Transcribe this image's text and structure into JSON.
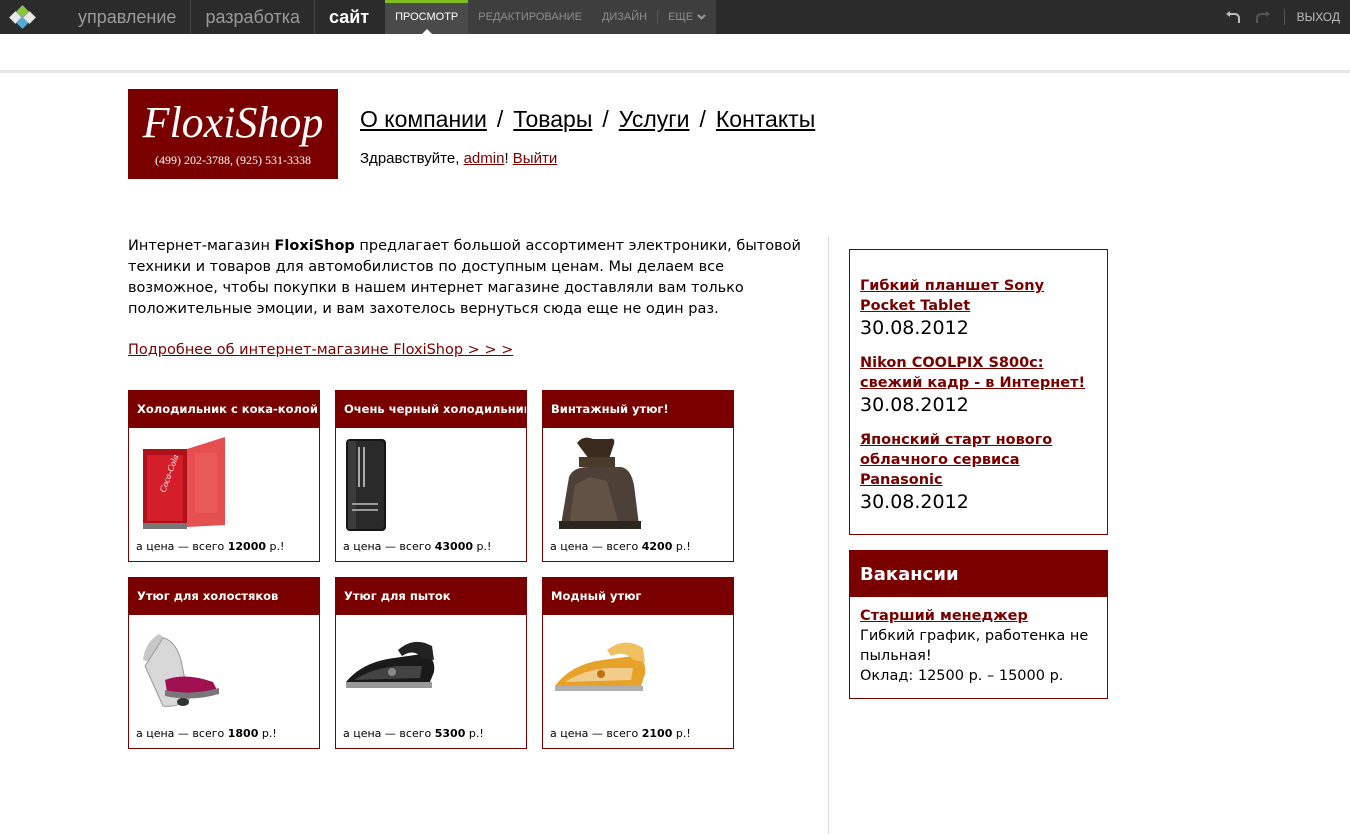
{
  "adminbar": {
    "main_nav": [
      "управление",
      "разработка",
      "сайт"
    ],
    "active_main": "сайт",
    "sub_nav": [
      "ПРОСМОТР",
      "РЕДАКТИРОВАНИЕ",
      "ДИЗАЙН"
    ],
    "more_label": "ЕЩЕ",
    "exit_label": "ВЫХОД",
    "accent": "#7fbf1f"
  },
  "brand": {
    "name": "FloxiShop",
    "phones": "(499) 202-3788, (925) 531-3338",
    "color": "#7a0000"
  },
  "menu": [
    "О компании",
    "Товары",
    "Услуги",
    "Контакты"
  ],
  "greeting": {
    "prefix": "Здравствуйте, ",
    "user": "admin",
    "suffix": "! ",
    "logout": "Выйти"
  },
  "intro": {
    "before": "Интернет-магазин ",
    "bold": "FloxiShop",
    "after": " предлагает большой ассортимент электроники, бытовой техники и товаров для автомобилистов по доступным ценам. Мы делаем все возможное, чтобы покупки в нашем интернет магазине доставляли вам только положительные эмоции, и вам захотелось вернуться сюда еще не один раз.",
    "more_link": "Подробнее об интернет-магазине FloxiShop > > >"
  },
  "products": [
    {
      "title": "Холодильник с кока-колой",
      "price_prefix": "а цена — всего ",
      "price": "12000",
      "currency": " р.!",
      "image": "red-mini-fridge"
    },
    {
      "title": "Очень черный холодильник",
      "price_prefix": "а цена — всего ",
      "price": "43000",
      "currency": " р.!",
      "image": "black-fridge"
    },
    {
      "title": "Винтажный утюг!",
      "price_prefix": "а цена — всего ",
      "price": "4200",
      "currency": " р.!",
      "image": "vintage-iron"
    },
    {
      "title": "Утюг для холостяков",
      "price_prefix": "а цена — всего ",
      "price": "1800",
      "currency": " р.!",
      "image": "steam-station-iron"
    },
    {
      "title": "Утюг для пыток",
      "price_prefix": "а цена — всего ",
      "price": "5300",
      "currency": " р.!",
      "image": "black-iron"
    },
    {
      "title": "Модный утюг",
      "price_prefix": "а цена — всего ",
      "price": "2100",
      "currency": " р.!",
      "image": "yellow-iron"
    }
  ],
  "news": [
    {
      "title": "Гибкий планшет Sony Pocket Tablet",
      "date": "30.08.2012"
    },
    {
      "title": "Nikon COOLPIX S800c: свежий кадр - в Интернет!",
      "date": "30.08.2012"
    },
    {
      "title": "Японский старт нового облачного сервиса Panasonic",
      "date": "30.08.2012"
    }
  ],
  "jobs": {
    "heading": "Вакансии",
    "title": "Старший менеджер",
    "desc": "Гибкий график, работенка не пыльная!",
    "salary": "Оклад: 12500 р.  – 15000 р."
  }
}
